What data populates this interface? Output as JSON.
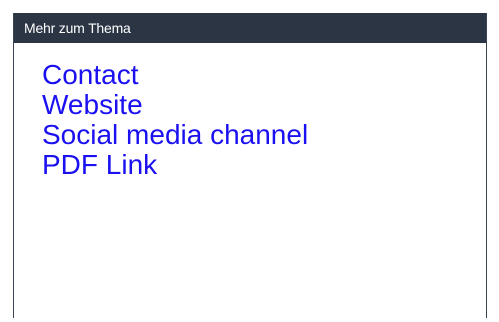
{
  "panel": {
    "header_title": "Mehr zum Thema",
    "links": [
      {
        "label": "Contact"
      },
      {
        "label": "Website"
      },
      {
        "label": "Social media channel"
      },
      {
        "label": "PDF Link"
      }
    ]
  },
  "colors": {
    "header_bg": "#2b3544",
    "header_text": "#ffffff",
    "link": "#1a10f0",
    "page_bg": "#ffffff"
  }
}
